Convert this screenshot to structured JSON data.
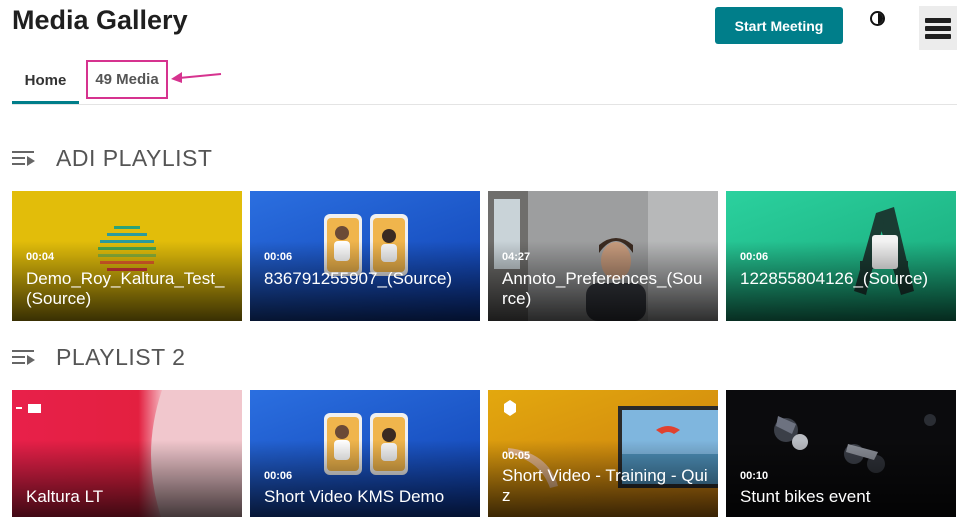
{
  "header": {
    "title": "Media Gallery",
    "start_meeting_label": "Start Meeting"
  },
  "tabs": [
    {
      "label": "Home"
    },
    {
      "label": "49 Media"
    }
  ],
  "colors": {
    "accent": "#007e8a",
    "highlight_box": "#d6338f"
  },
  "sections": [
    {
      "title": "ADI PLAYLIST",
      "items": [
        {
          "duration": "00:04",
          "title": "Demo_Roy_Kaltura_Test_(Source)"
        },
        {
          "duration": "00:06",
          "title": "836791255907_(Source)"
        },
        {
          "duration": "04:27",
          "title": "Annoto_Preferences_(Source)"
        },
        {
          "duration": "00:06",
          "title": "122855804126_(Source)"
        }
      ]
    },
    {
      "title": "PLAYLIST 2",
      "items": [
        {
          "duration": "",
          "title": "Kaltura LT"
        },
        {
          "duration": "00:06",
          "title": "Short Video KMS Demo"
        },
        {
          "duration": "00:05",
          "title": "Short Video - Training - Quiz"
        },
        {
          "duration": "00:10",
          "title": "Stunt bikes event"
        }
      ]
    }
  ]
}
